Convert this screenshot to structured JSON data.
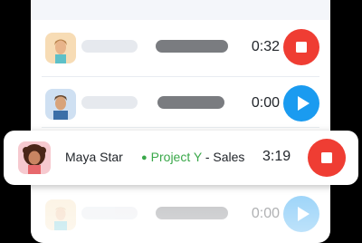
{
  "colors": {
    "stop": "#ef3d33",
    "play": "#1a9bf0",
    "project_green": "#3aa84a",
    "text": "#22262b"
  },
  "rows": [
    {
      "time": "0:32",
      "action": "stop",
      "action_icon": "stop-icon"
    },
    {
      "time": "0:00",
      "action": "play",
      "action_icon": "play-icon"
    },
    {
      "name": "Maya Star",
      "project": "Project Y",
      "separator": "- Sales",
      "time": "3:19",
      "action": "stop",
      "action_icon": "stop-icon",
      "highlighted": true
    },
    {
      "time": "0:00",
      "action": "play",
      "action_icon": "play-icon"
    }
  ]
}
